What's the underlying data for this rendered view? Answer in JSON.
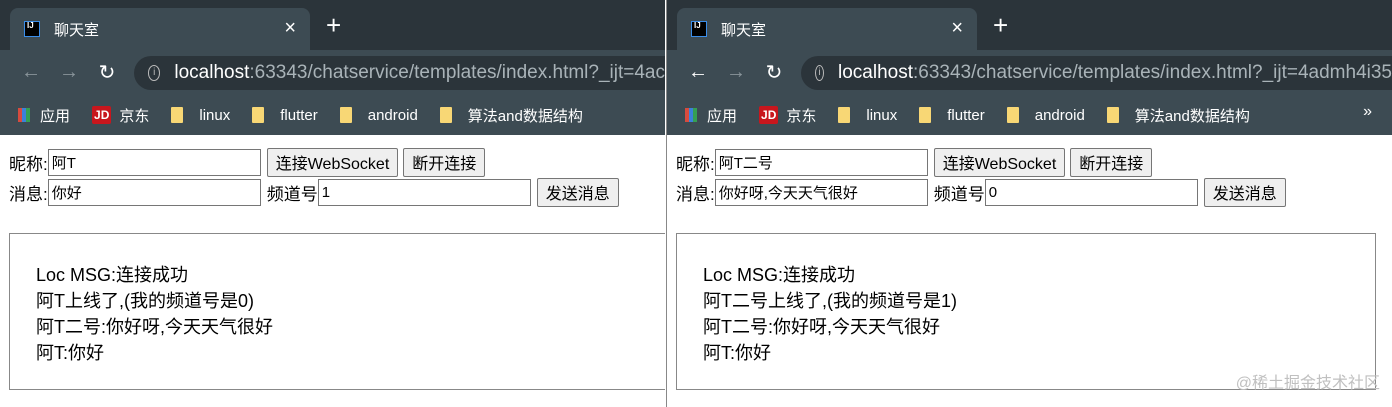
{
  "windows": [
    {
      "tab_title": "聊天室",
      "url_host": "localhost",
      "url_rest": ":63343/chatservice/templates/index.html?_ijt=4ac",
      "bookmarks": [
        "应用",
        "京东",
        "linux",
        "flutter",
        "android",
        "算法and数据结构"
      ],
      "nickname_label": "昵称:",
      "nickname_value": "阿T",
      "connect_label": "连接WebSocket",
      "disconnect_label": "断开连接",
      "message_label": "消息:",
      "message_value": "你好",
      "channel_label": "频道号",
      "channel_value": "1",
      "send_label": "发送消息",
      "log": [
        "Loc MSG:连接成功",
        "阿T上线了,(我的频道号是0)",
        "阿T二号:你好呀,今天天气很好",
        "阿T:你好"
      ]
    },
    {
      "tab_title": "聊天室",
      "url_host": "localhost",
      "url_rest": ":63343/chatservice/templates/index.html?_ijt=4admh4i35",
      "bookmarks": [
        "应用",
        "京东",
        "linux",
        "flutter",
        "android",
        "算法and数据结构"
      ],
      "more": "»",
      "nickname_label": "昵称:",
      "nickname_value": "阿T二号",
      "connect_label": "连接WebSocket",
      "disconnect_label": "断开连接",
      "message_label": "消息:",
      "message_value": "你好呀,今天天气很好",
      "channel_label": "频道号",
      "channel_value": "0",
      "send_label": "发送消息",
      "log": [
        "Loc MSG:连接成功",
        "阿T二号上线了,(我的频道号是1)",
        "阿T二号:你好呀,今天天气很好",
        "阿T:你好"
      ]
    }
  ],
  "watermark": "@稀土掘金技术社区"
}
